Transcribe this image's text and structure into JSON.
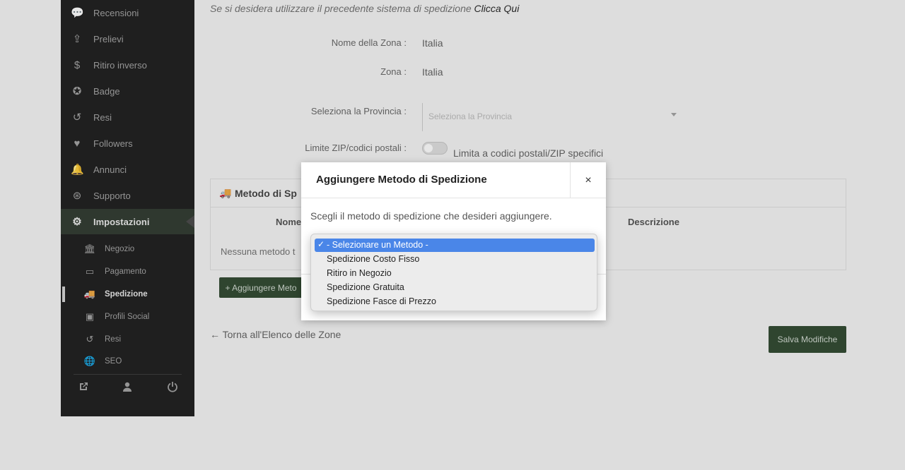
{
  "sidebar": {
    "items": [
      {
        "label": "Recensioni",
        "icon": "comments-icon",
        "glyph": "💬"
      },
      {
        "label": "Prelievi",
        "icon": "upload-icon",
        "glyph": "⇪"
      },
      {
        "label": "Ritiro inverso",
        "icon": "dollar-icon",
        "glyph": "$"
      },
      {
        "label": "Badge",
        "icon": "badge-icon",
        "glyph": "✪"
      },
      {
        "label": "Resi",
        "icon": "undo-icon",
        "glyph": "↺"
      },
      {
        "label": "Followers",
        "icon": "heart-icon",
        "glyph": "♥"
      },
      {
        "label": "Annunci",
        "icon": "bell-icon",
        "glyph": "🔔"
      },
      {
        "label": "Supporto",
        "icon": "lifering-icon",
        "glyph": "⊛"
      },
      {
        "label": "Impostazioni",
        "icon": "gear-icon",
        "glyph": "⚙"
      }
    ],
    "sub_items": [
      {
        "label": "Negozio",
        "icon": "store-icon",
        "glyph": "🏛"
      },
      {
        "label": "Pagamento",
        "icon": "credit-card-icon",
        "glyph": "▭"
      },
      {
        "label": "Spedizione",
        "icon": "truck-icon",
        "glyph": "🚚"
      },
      {
        "label": "Profili Social",
        "icon": "share-icon",
        "glyph": "▣"
      },
      {
        "label": "Resi",
        "icon": "undo-icon",
        "glyph": "↺"
      },
      {
        "label": "SEO",
        "icon": "globe-icon",
        "glyph": "🌐"
      }
    ]
  },
  "main": {
    "notice": "Se si desidera utilizzare il precedente sistema di spedizione",
    "notice_link": "Clicca Qui",
    "zone_name_label": "Nome della Zona :",
    "zone_name_value": "Italia",
    "zone_label": "Zona :",
    "zone_value": "Italia",
    "province_label": "Seleziona la Provincia :",
    "province_placeholder": "Seleziona la Provincia",
    "zip_label": "Limite ZIP/codici postali :",
    "zip_toggle_text": "Limita a codici postali/ZIP specifici",
    "methods_card_title": "Metodo di Sp",
    "col_name": "Nome",
    "col_description": "Descrizione",
    "empty_row": "Nessuna metodo t",
    "add_method_button": "+ Aggiungere Meto",
    "back_link": "← Torna all'Elenco delle Zone",
    "save_button": "Salva Modifiche"
  },
  "modal": {
    "title": "Aggiungere Metodo di Spedizione",
    "close": "×",
    "prompt": "Scegli il metodo di spedizione che desideri aggiungere.",
    "options": [
      "- Selezionare un Metodo -",
      "Spedizione Costo Fisso",
      "Ritiro in Negozio",
      "Spedizione Gratuita",
      "Spedizione Fasce di Prezzo"
    ],
    "selected_index": 0,
    "check_mark": "✓"
  },
  "colors": {
    "sidebar_bg": "#0b0b0b",
    "accent_dark_green": "#1f3a1f",
    "selected_option": "#4a86e8"
  }
}
